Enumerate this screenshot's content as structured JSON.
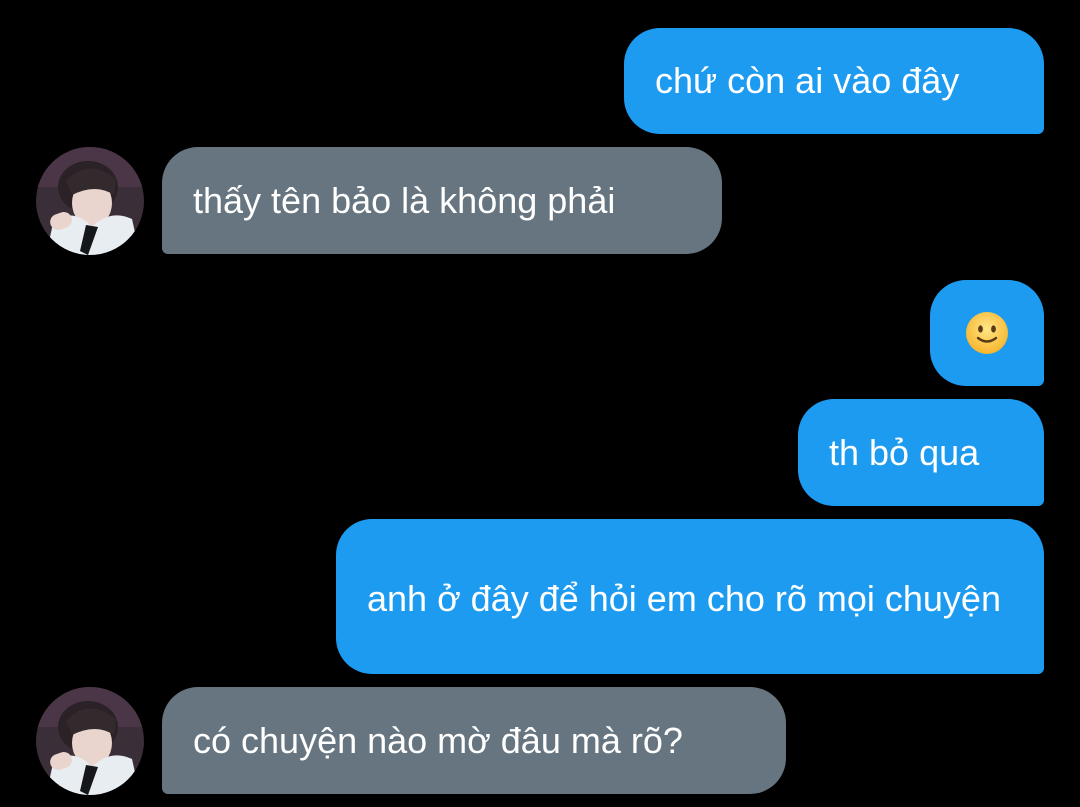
{
  "messages": [
    {
      "direction": "outgoing",
      "text": "chứ còn ai vào đây"
    },
    {
      "direction": "incoming",
      "text": "thấy tên bảo là không phải"
    },
    {
      "direction": "outgoing",
      "emoji": "slightly-smiling-face-emoji"
    },
    {
      "direction": "outgoing",
      "text": "th bỏ qua"
    },
    {
      "direction": "outgoing",
      "text": "anh ở đây để hỏi em cho rõ mọi chuyện"
    },
    {
      "direction": "incoming",
      "text": "có chuyện nào mờ đâu mà rõ?"
    }
  ],
  "colors": {
    "background": "#000000",
    "outgoing_bubble": "#1d9bf0",
    "incoming_bubble": "#66757f",
    "text": "#ffffff"
  }
}
